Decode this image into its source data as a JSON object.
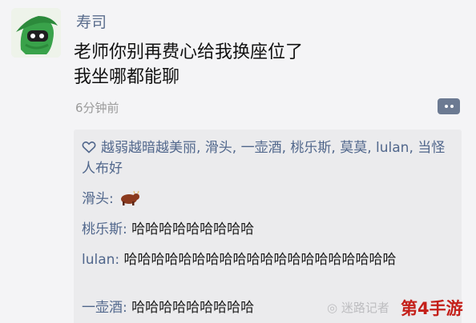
{
  "post": {
    "author": "寿司",
    "lines": [
      "老师你别再费心给我换座位了",
      "我坐哪都能聊"
    ],
    "time": "6分钟前"
  },
  "likes": {
    "text": "越弱越暗越美丽, 滑头, 一壶酒, 桃乐斯, 莫莫, lulan, 当怪人布好"
  },
  "comments": [
    {
      "author": "滑头: ",
      "text": "",
      "icon": "cow-icon"
    },
    {
      "author": "桃乐斯: ",
      "text": "哈哈哈哈哈哈哈哈哈"
    },
    {
      "author": "lulan: ",
      "text": "哈哈哈哈哈哈哈哈哈哈哈哈哈哈哈哈哈哈哈哈"
    },
    {
      "author": "一壶酒: ",
      "text": "哈哈哈哈哈哈哈哈哈"
    }
  ],
  "watermark": {
    "brand": "第4手游",
    "faint": "◎ 迷路记者"
  },
  "colors": {
    "link": "#51678c",
    "panel": "#ebebed",
    "watermark": "#c4201a"
  }
}
